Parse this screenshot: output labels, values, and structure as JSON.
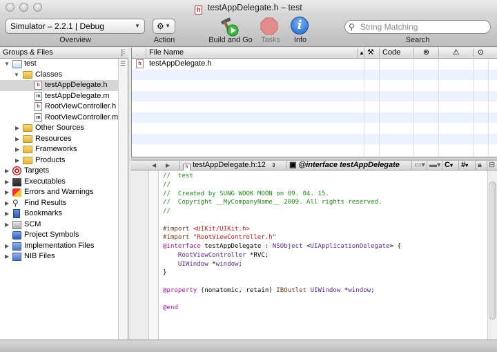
{
  "window": {
    "title": "testAppDelegate.h – test",
    "title_icon": "h"
  },
  "toolbar": {
    "overview_value": "Simulator – 2.2.1 | Debug",
    "overview_label": "Overview",
    "action_icon": "⚙",
    "action_label": "Action",
    "build_label": "Build and Go",
    "tasks_label": "Tasks",
    "info_label": "Info",
    "info_icon": "i",
    "search_placeholder": "String Matching",
    "search_label": "Search"
  },
  "sidebar": {
    "header": "Groups & Files",
    "items": [
      {
        "label": "test"
      },
      {
        "label": "Classes"
      },
      {
        "label": "testAppDelegate.h",
        "ext": "h"
      },
      {
        "label": "testAppDelegate.m",
        "ext": "m"
      },
      {
        "label": "RootViewController.h",
        "ext": "h"
      },
      {
        "label": "RootViewController.m",
        "ext": "m"
      },
      {
        "label": "Other Sources"
      },
      {
        "label": "Resources"
      },
      {
        "label": "Frameworks"
      },
      {
        "label": "Products"
      },
      {
        "label": "Targets"
      },
      {
        "label": "Executables"
      },
      {
        "label": "Errors and Warnings"
      },
      {
        "label": "Find Results"
      },
      {
        "label": "Bookmarks"
      },
      {
        "label": "SCM"
      },
      {
        "label": "Project Symbols"
      },
      {
        "label": "Implementation Files"
      },
      {
        "label": "NIB Files"
      }
    ]
  },
  "filelist": {
    "col_name": "File Name",
    "col_code": "Code",
    "rows": [
      {
        "name": "testAppDelegate.h",
        "ext": "h"
      }
    ]
  },
  "editor": {
    "file_popup": "testAppDelegate.h:12",
    "symbol_popup": "@interface testAppDelegate",
    "lang_popup": "C",
    "hash_popup": "#"
  },
  "code": {
    "l1": "//  test",
    "l2": "//",
    "l3": "//  Created by SUNG WOOK MOON on 09. 04. 15.",
    "l4": "//  Copyright __MyCompanyName__ 2009. All rights reserved.",
    "l5": "//",
    "l7a": "#import ",
    "l7b": "<UIKit/UIKit.h>",
    "l8a": "#import ",
    "l8b": "\"RootViewController.h\"",
    "l9a": "@interface",
    "l9b": " testAppDelegate : ",
    "l9c": "NSObject",
    "l9d": " <",
    "l9e": "UIApplicationDelegate",
    "l9f": "> {",
    "l10a": "    ",
    "l10b": "RootViewController",
    "l10c": " *RVC;",
    "l11a": "    ",
    "l11b": "UIWindow",
    "l11c": " *",
    "l11d": "window",
    "l11e": ";",
    "l12": "}",
    "l14a": "@property",
    "l14b": " (nonatomic, retain) ",
    "l14c": "IBOutlet",
    "l14d": " ",
    "l14e": "UIWindow",
    "l14f": " *",
    "l14g": "window",
    "l14h": ";",
    "l16": "@end"
  }
}
